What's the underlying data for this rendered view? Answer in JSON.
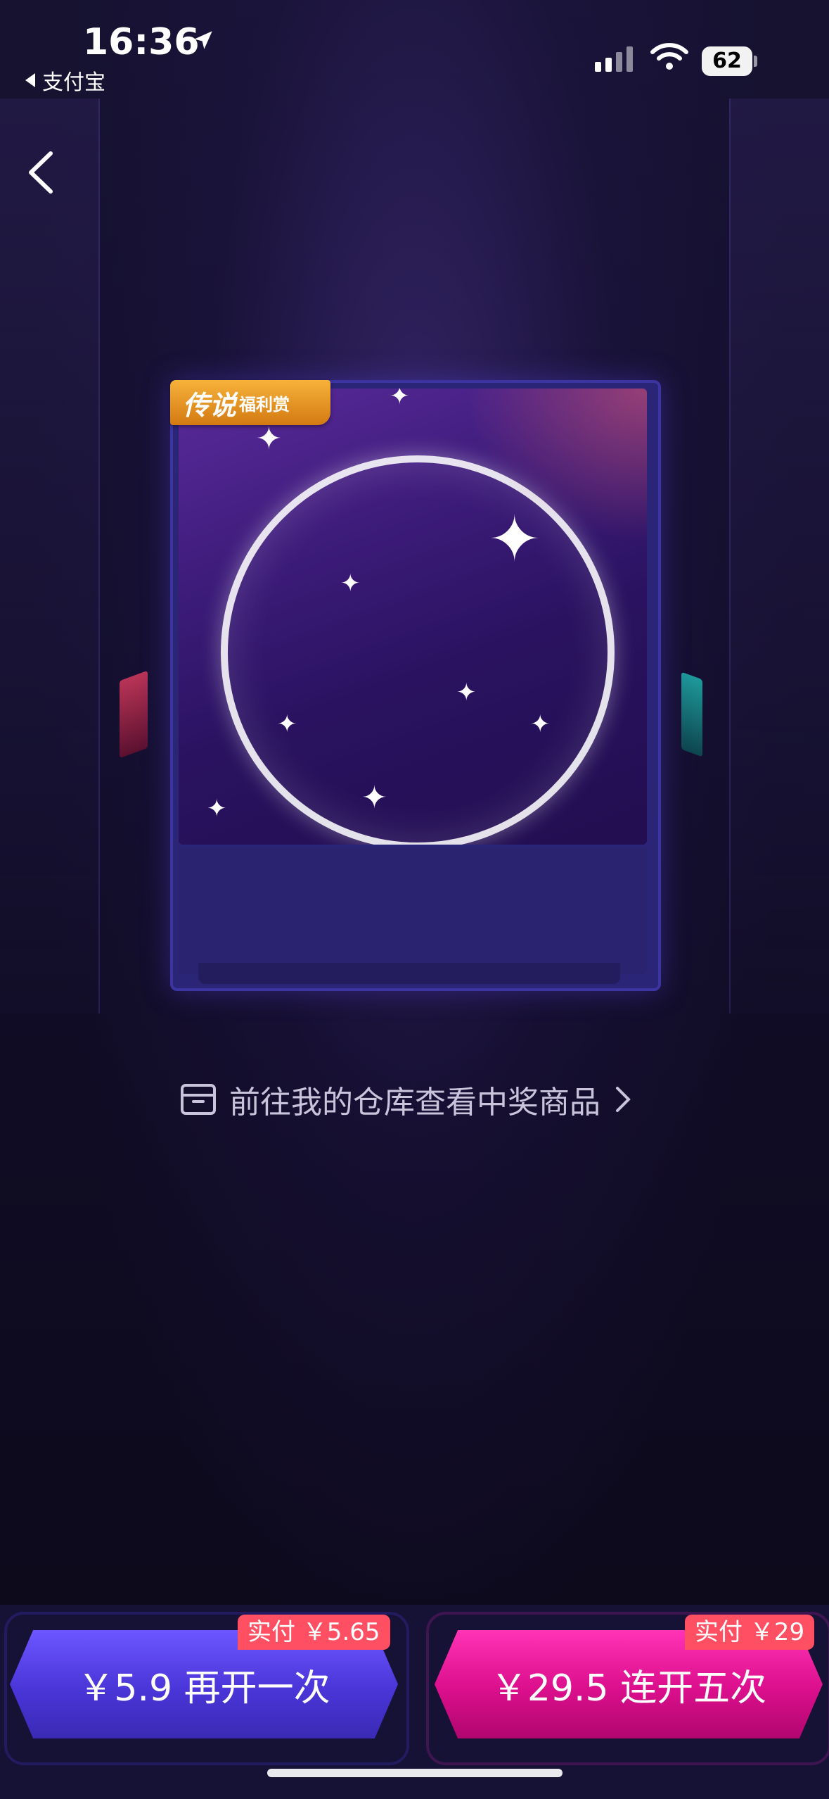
{
  "status_bar": {
    "time": "16:36",
    "back_app": "支付宝",
    "battery": "62",
    "location_icon": "location-arrow-icon",
    "signal_icon": "cellular-signal-icon",
    "wifi_icon": "wifi-icon"
  },
  "nav": {
    "back_icon": "chevron-left-icon"
  },
  "card": {
    "badge_main": "传说",
    "badge_sub": "福利赏",
    "image_subject": "crystal-bubble"
  },
  "warehouse_link": {
    "label": "前往我的仓库查看中奖商品",
    "icon": "box-icon",
    "arrow_icon": "chevron-right-icon"
  },
  "actions": {
    "open_once": {
      "label": "￥5.9 再开一次",
      "actual_pay": "实付 ￥5.65"
    },
    "open_five": {
      "label": "￥29.5 连开五次",
      "actual_pay": "实付 ￥29"
    }
  },
  "colors": {
    "accent_blue": "#5a45f0",
    "accent_pink": "#e8139a",
    "tag_red": "#ff4f62",
    "badge_orange": "#e8951f"
  }
}
